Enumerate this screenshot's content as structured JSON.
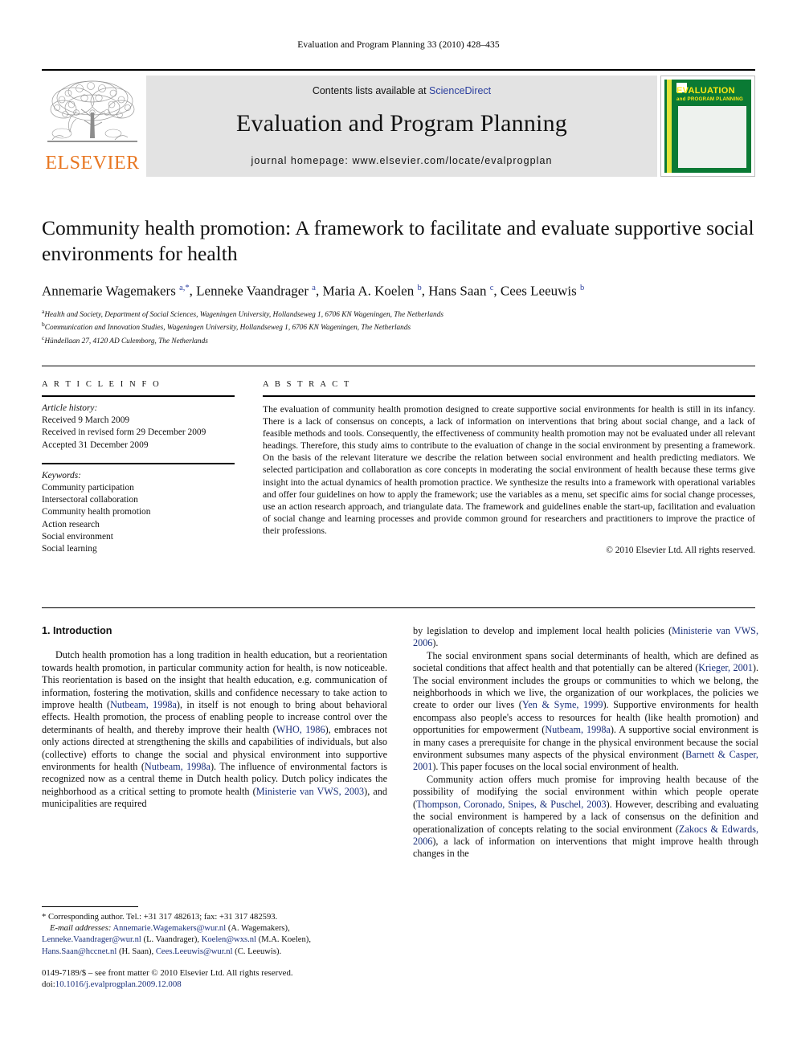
{
  "running_head": "Evaluation and Program Planning 33 (2010) 428–435",
  "masthead": {
    "publisher_name": "ELSEVIER",
    "contents_prefix": "Contents lists available at ",
    "contents_link": "ScienceDirect",
    "journal_title": "Evaluation and Program Planning",
    "homepage": "journal homepage: www.elsevier.com/locate/evalprogplan",
    "cover": {
      "line1": "EVALUATION",
      "line2": "and PROGRAM PLANNING"
    }
  },
  "article": {
    "title": "Community health promotion: A framework to facilitate and evaluate supportive social environments for health",
    "authors_html": "Annemarie Wagemakers <sup>a,*</sup>, Lenneke Vaandrager <sup>a</sup>, Maria A. Koelen <sup>b</sup>, Hans Saan <sup>c</sup>, Cees Leeuwis <sup>b</sup>",
    "affiliations": [
      {
        "marker": "a",
        "text": "Health and Society, Department of Social Sciences, Wageningen University, Hollandseweg 1, 6706 KN Wageningen, The Netherlands"
      },
      {
        "marker": "b",
        "text": "Communication and Innovation Studies, Wageningen University, Hollandseweg 1, 6706 KN Wageningen, The Netherlands"
      },
      {
        "marker": "c",
        "text": "Hündellaan 27, 4120 AD Culemborg, The Netherlands"
      }
    ]
  },
  "article_info": {
    "heading": "A R T I C L E   I N F O",
    "history_label": "Article history:",
    "history": [
      "Received 9 March 2009",
      "Received in revised form 29 December 2009",
      "Accepted 31 December 2009"
    ],
    "keywords_label": "Keywords:",
    "keywords": [
      "Community participation",
      "Intersectoral collaboration",
      "Community health promotion",
      "Action research",
      "Social environment",
      "Social learning"
    ]
  },
  "abstract": {
    "heading": "A B S T R A C T",
    "text": "The evaluation of community health promotion designed to create supportive social environments for health is still in its infancy. There is a lack of consensus on concepts, a lack of information on interventions that bring about social change, and a lack of feasible methods and tools. Consequently, the effectiveness of community health promotion may not be evaluated under all relevant headings. Therefore, this study aims to contribute to the evaluation of change in the social environment by presenting a framework. On the basis of the relevant literature we describe the relation between social environment and health predicting mediators. We selected participation and collaboration as core concepts in moderating the social environment of health because these terms give insight into the actual dynamics of health promotion practice. We synthesize the results into a framework with operational variables and offer four guidelines on how to apply the framework; use the variables as a menu, set specific aims for social change processes, use an action research approach, and triangulate data. The framework and guidelines enable the start-up, facilitation and evaluation of social change and learning processes and provide common ground for researchers and practitioners to improve the practice of their professions.",
    "copyright": "© 2010 Elsevier Ltd. All rights reserved."
  },
  "introduction": {
    "heading": "1. Introduction",
    "left_paragraphs": [
      "Dutch health promotion has a long tradition in health education, but a reorientation towards health promotion, in particular community action for health, is now noticeable. This reorientation is based on the insight that health education, e.g. communication of information, fostering the motivation, skills and confidence necessary to take action to improve health (<span class=\"ref\">Nutbeam, 1998a</span>), in itself is not enough to bring about behavioral effects. Health promotion, the process of enabling people to increase control over the determinants of health, and thereby improve their health (<span class=\"ref\">WHO, 1986</span>), embraces not only actions directed at strengthening the skills and capabilities of individuals, but also (collective) efforts to change the social and physical environment into supportive environments for health (<span class=\"ref\">Nutbeam, 1998a</span>). The influence of environmental factors is recognized now as a central theme in Dutch health policy. Dutch policy indicates the neighborhood as a critical setting to promote health (<span class=\"ref\">Ministerie van VWS, 2003</span>), and municipalities are required"
    ],
    "right_paragraphs": [
      "by legislation to develop and implement local health policies (<span class=\"ref\">Ministerie van VWS, 2006</span>).",
      "The social environment spans social determinants of health, which are defined as societal conditions that affect health and that potentially can be altered (<span class=\"ref\">Krieger, 2001</span>). The social environment includes the groups or communities to which we belong, the neighborhoods in which we live, the organization of our workplaces, the policies we create to order our lives (<span class=\"ref\">Yen &amp; Syme, 1999</span>). Supportive environments for health encompass also people's access to resources for health (like health promotion) and opportunities for empowerment (<span class=\"ref\">Nutbeam, 1998a</span>). A supportive social environment is in many cases a prerequisite for change in the physical environment because the social environment subsumes many aspects of the physical environment (<span class=\"ref\">Barnett &amp; Casper, 2001</span>). This paper focuses on the local social environment of health.",
      "Community action offers much promise for improving health because of the possibility of modifying the social environment within which people operate (<span class=\"ref\">Thompson, Coronado, Snipes, &amp; Puschel, 2003</span>). However, describing and evaluating the social environment is hampered by a lack of consensus on the definition and operationalization of concepts relating to the social environment (<span class=\"ref\">Zakocs &amp; Edwards, 2006</span>), a lack of information on interventions that might improve health through changes in the"
    ]
  },
  "footnotes": {
    "corresponding": "* Corresponding author. Tel.: +31 317 482613; fax: +31 317 482593.",
    "email_label": "E-mail addresses:",
    "emails_html": "<span class=\"ref\">Annemarie.Wagemakers@wur.nl</span> (A. Wagemakers), <span class=\"ref\">Lenneke.Vaandrager@wur.nl</span> (L. Vaandrager), <span class=\"ref\">Koelen@wxs.nl</span> (M.A. Koelen), <span class=\"ref\">Hans.Saan@hccnet.nl</span> (H. Saan), <span class=\"ref\">Cees.Leeuwis@wur.nl</span> (C. Leeuwis)."
  },
  "imprint": {
    "line1": "0149-7189/$ – see front matter © 2010 Elsevier Ltd. All rights reserved.",
    "doi_prefix": "doi:",
    "doi": "10.1016/j.evalprogplan.2009.12.008"
  },
  "colors": {
    "link_blue": "#2a3e9e",
    "ref_blue": "#1a2f7a",
    "elsevier_orange": "#e87722",
    "band_gray": "#e3e3e3",
    "cover_green": "#0a7a34",
    "cover_yellow": "#ffe812"
  }
}
